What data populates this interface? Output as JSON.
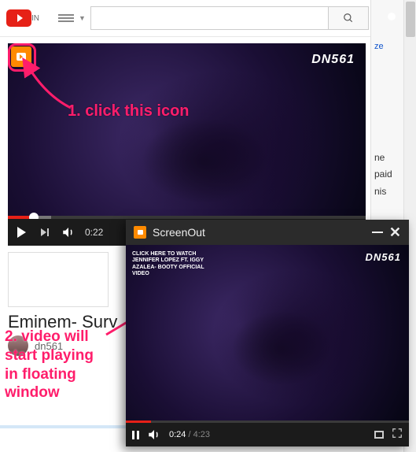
{
  "topbar": {
    "logo_suffix": "IN",
    "search_placeholder": "",
    "search_value": ""
  },
  "main_video": {
    "watermark": "DN561",
    "time_elapsed": "0:22"
  },
  "below": {
    "title": "Eminem- Surv",
    "uploader": "dn561"
  },
  "annotations": {
    "step1": "1.  click this icon",
    "step2_l1": "2. video will",
    "step2_l2": "start playing",
    "step2_l3": "in floating",
    "step2_l4": "window"
  },
  "popup": {
    "title": "ScreenOut",
    "overlay_l1": "CLICK HERE TO WATCH",
    "overlay_l2": "JENNIFER LOPEZ FT. IGGY",
    "overlay_l3": "AZALEA- BOOTY OFFICIAL",
    "overlay_l4": "VIDEO",
    "watermark": "DN561",
    "time_elapsed": "0:24",
    "time_total": "4:23"
  },
  "rightstrip": {
    "link": "ze",
    "t1": "ne",
    "t2": "paid",
    "t3": "nis"
  }
}
